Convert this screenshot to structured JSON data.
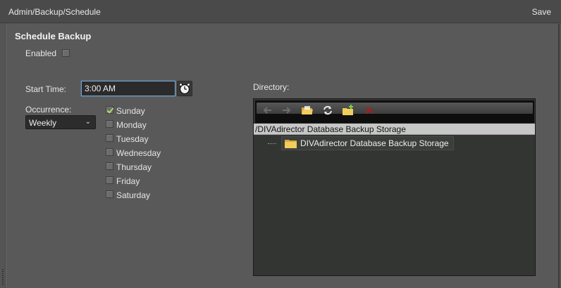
{
  "header": {
    "breadcrumb": "Admin/Backup/Schedule",
    "save_label": "Save"
  },
  "form": {
    "title": "Schedule Backup",
    "enabled_label": "Enabled",
    "enabled_checked": false,
    "start_time_label": "Start Time:",
    "start_time_value": "3:00 AM",
    "occurrence_label": "Occurrence:",
    "occurrence_value": "Weekly",
    "days": [
      {
        "label": "Sunday",
        "checked": true
      },
      {
        "label": "Monday",
        "checked": false
      },
      {
        "label": "Tuesday",
        "checked": false
      },
      {
        "label": "Wednesday",
        "checked": false
      },
      {
        "label": "Thursday",
        "checked": false
      },
      {
        "label": "Friday",
        "checked": false
      },
      {
        "label": "Saturday",
        "checked": false
      }
    ]
  },
  "directory": {
    "label": "Directory:",
    "path": "/DIVAdirector Database Backup Storage",
    "tree_items": [
      "DIVAdirector Database Backup Storage"
    ],
    "toolbar_icons": [
      "back-arrow-icon",
      "forward-arrow-icon",
      "open-folder-icon",
      "refresh-icon",
      "new-folder-icon",
      "delete-icon"
    ]
  },
  "colors": {
    "background": "#595959",
    "input_focus": "#7aa3c9",
    "check_mark": "#a8e06a",
    "folder": "#e8c34a",
    "delete": "#b01a1a"
  }
}
